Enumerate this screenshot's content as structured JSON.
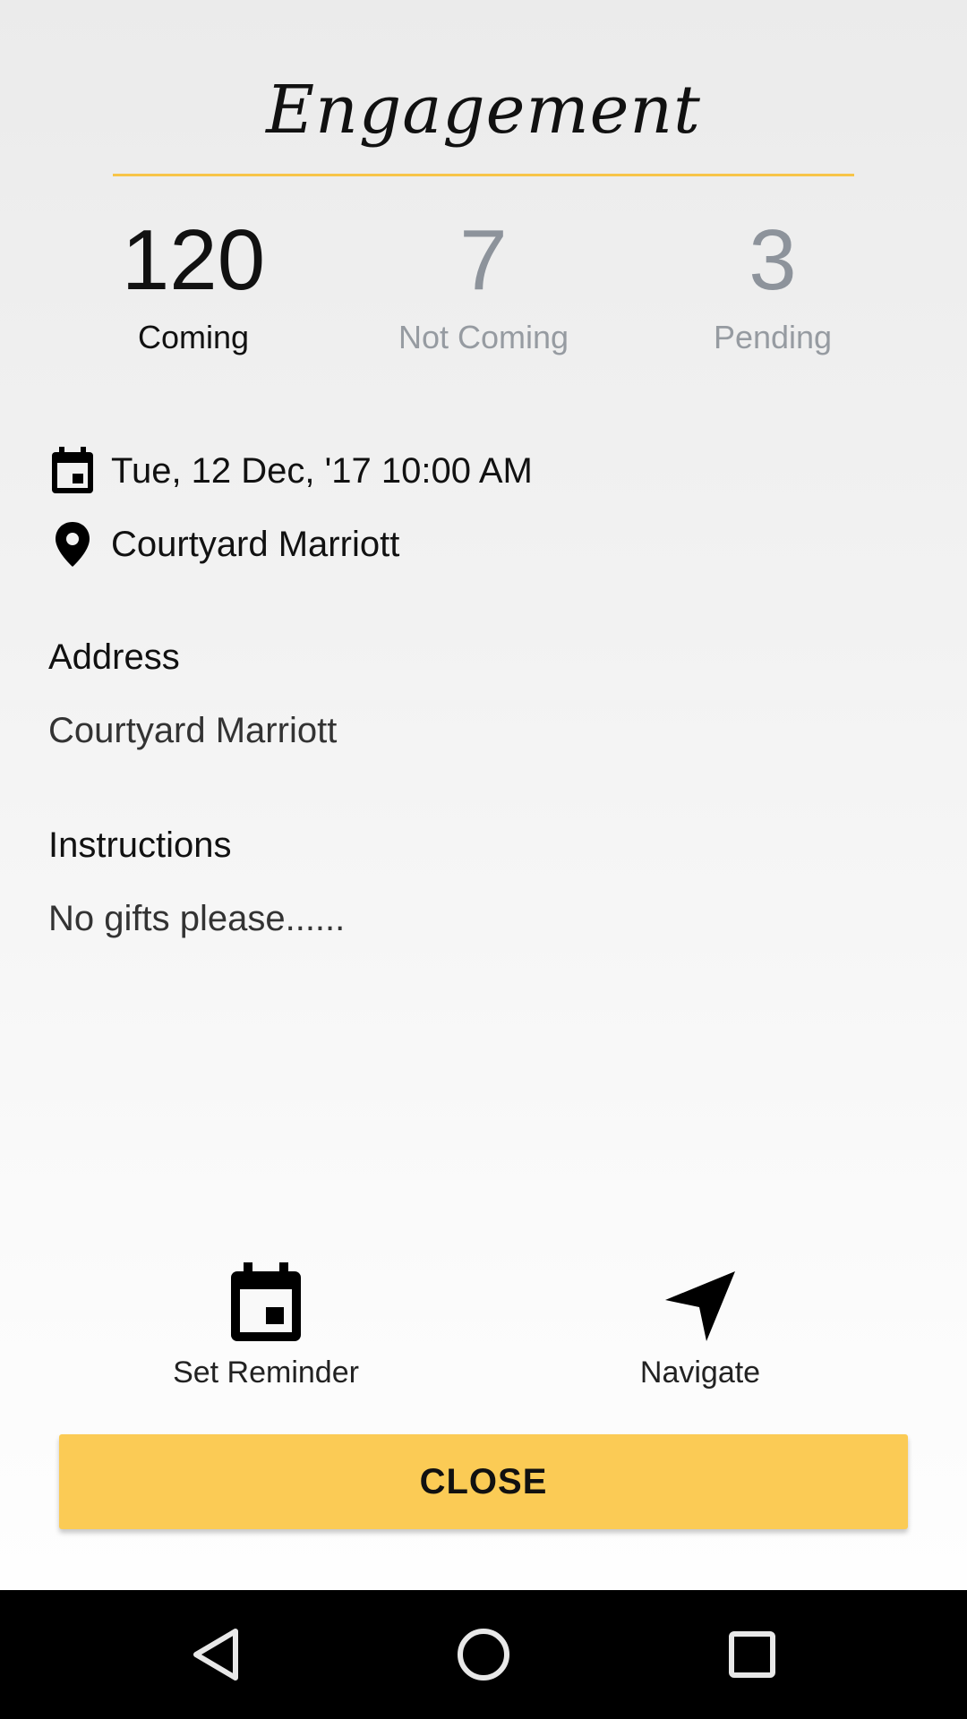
{
  "event": {
    "title": "Engagement"
  },
  "stats": {
    "coming": {
      "value": "120",
      "label": "Coming"
    },
    "not_coming": {
      "value": "7",
      "label": "Not Coming"
    },
    "pending": {
      "value": "3",
      "label": "Pending"
    }
  },
  "details": {
    "datetime": "Tue, 12 Dec, '17 10:00 AM",
    "venue": "Courtyard Marriott"
  },
  "address": {
    "label": "Address",
    "value": "Courtyard Marriott"
  },
  "instructions": {
    "label": "Instructions",
    "value": "No gifts please......"
  },
  "actions": {
    "reminder_label": "Set Reminder",
    "navigate_label": "Navigate"
  },
  "close_button": {
    "label": "CLOSE"
  },
  "icons": {
    "date": "calendar-icon",
    "venue": "location-pin-icon",
    "reminder": "calendar-icon",
    "navigate": "navigation-arrow-icon",
    "back": "back-triangle-icon",
    "home": "home-circle-icon",
    "recents": "recents-square-icon"
  },
  "colors": {
    "accent": "#fbcb55",
    "underline": "#f7c548",
    "muted": "#8d939b"
  }
}
